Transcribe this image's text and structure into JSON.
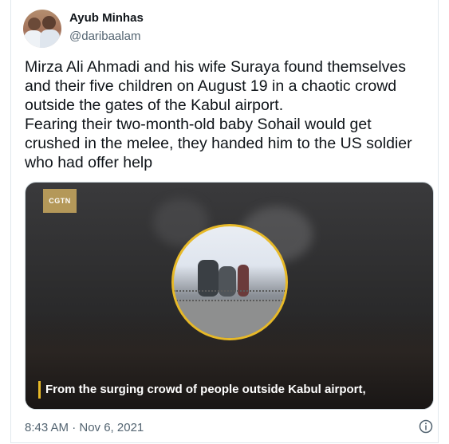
{
  "tweet": {
    "author_name": "Ayub Minhas",
    "author_handle": "@daribaalam",
    "text": "Mirza Ali Ahmadi and his wife Suraya found themselves\nand their five children on August 19 in a chaotic crowd\noutside the gates of the Kabul airport.\nFearing their two-month-old baby Sohail would get\ncrushed in the melee, they handed him to the US soldier\nwho had offer help",
    "media": {
      "logo_text": "CGTN",
      "caption": "From the surging crowd of people outside Kabul airport,"
    },
    "timestamp": "8:43 AM · Nov 6, 2021"
  },
  "colors": {
    "accent": "#e7b928",
    "secondary_text": "#536471",
    "primary_text": "#0f1419"
  },
  "icons": {
    "info": "info-icon"
  }
}
